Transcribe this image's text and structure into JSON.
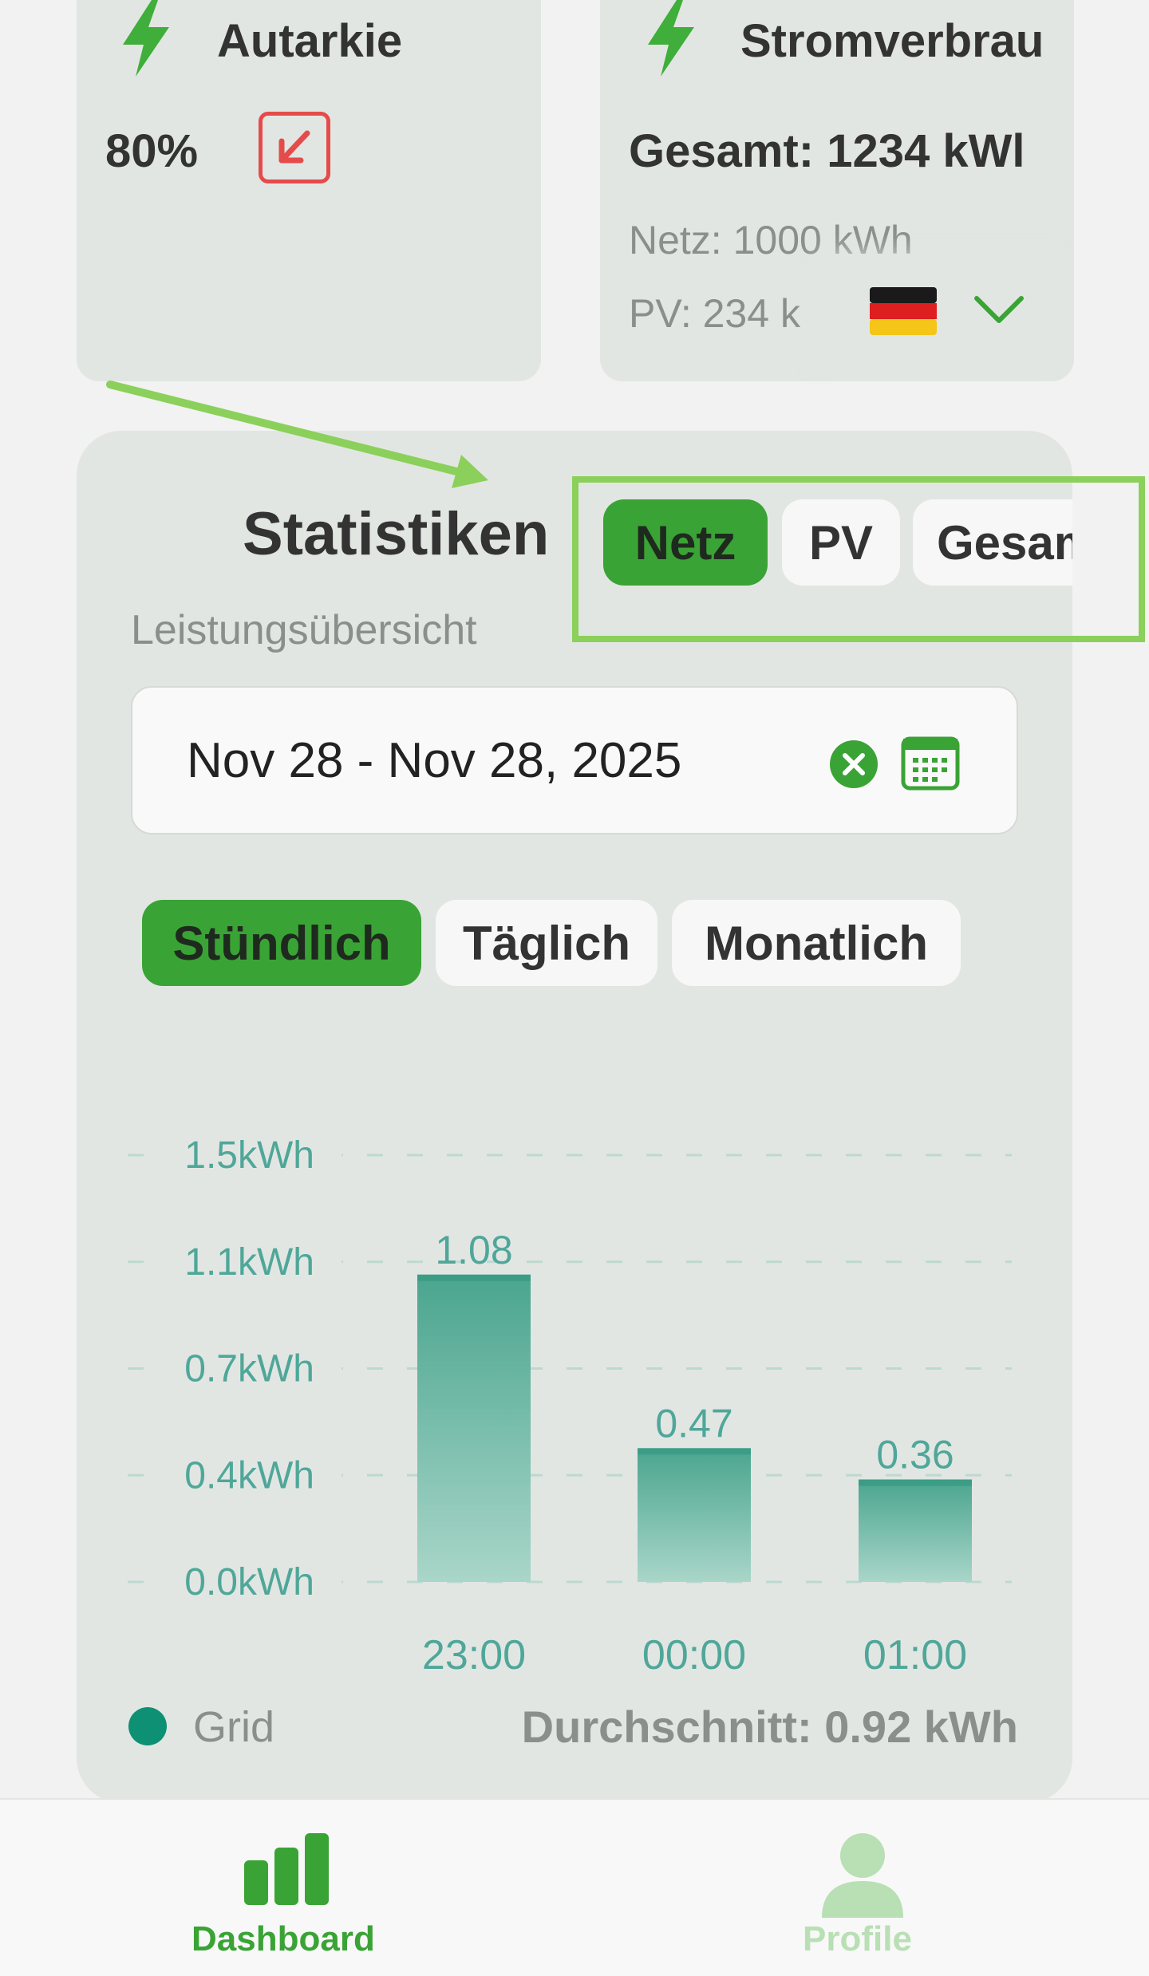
{
  "cards": {
    "autarkie": {
      "title": "Autarkie",
      "value": "80%"
    },
    "stromverbrauch": {
      "title": "Stromverbrau",
      "total": "Gesamt: 1234 kWl",
      "netz": "Netz: 1000 kWh",
      "pv": "PV: 234 k"
    }
  },
  "language": {
    "flag": "german-flag-icon"
  },
  "statistics": {
    "title": "Statistiken",
    "subtitle": "Leistungsübersicht",
    "source_tabs": [
      {
        "label": "Netz",
        "active": true
      },
      {
        "label": "PV",
        "active": false
      },
      {
        "label": "Gesamt",
        "active": false
      }
    ],
    "date_range": "Nov 28 - Nov 28, 2025",
    "period_tabs": [
      {
        "label": "Stündlich",
        "active": true
      },
      {
        "label": "Täglich",
        "active": false
      },
      {
        "label": "Monatlich",
        "active": false
      }
    ],
    "legend": "Grid",
    "average": "Durchschnitt: 0.92 kWh"
  },
  "chart_data": {
    "type": "bar",
    "categories": [
      "23:00",
      "00:00",
      "01:00"
    ],
    "values": [
      1.08,
      0.47,
      0.36
    ],
    "value_labels": [
      "1.08",
      "0.47",
      "0.36"
    ],
    "y_ticks": [
      "0.0kWh",
      "0.4kWh",
      "0.7kWh",
      "1.1kWh",
      "1.5kWh"
    ],
    "y_tick_values": [
      0,
      0.375,
      0.75,
      1.125,
      1.5
    ],
    "ylim": [
      0,
      1.5
    ],
    "series": [
      {
        "name": "Grid",
        "values": [
          1.08,
          0.47,
          0.36
        ]
      }
    ],
    "grid": true,
    "legend_position": "bottom-left"
  },
  "nav": {
    "dashboard": "Dashboard",
    "profile": "Profile"
  },
  "colors": {
    "accent_green": "#3aa335",
    "bar_teal": "#4fa799",
    "trend_red": "#e54b4b",
    "highlight_box": "#8bd05a"
  }
}
